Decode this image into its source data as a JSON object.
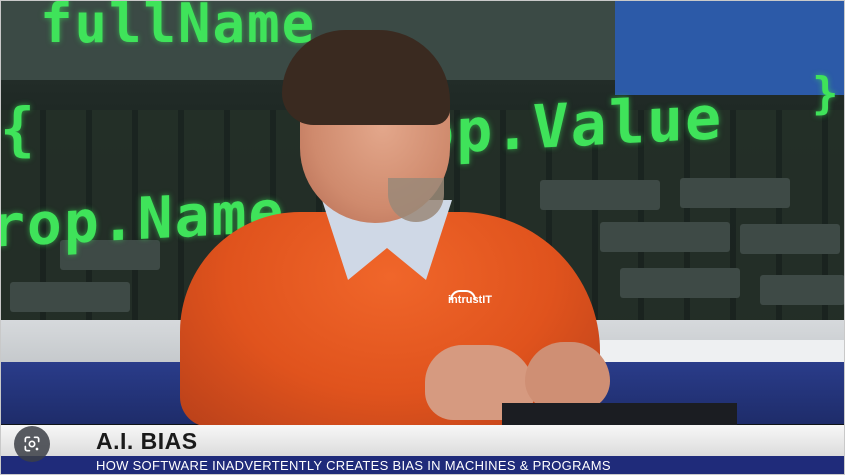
{
  "background": {
    "code_lines": [
      "fullName",
      "rop.Value",
      "rop.Name",
      "{",
      "}"
    ]
  },
  "shirt_logo": "intrustIT",
  "lower_third": {
    "title": "A.I. BIAS",
    "subtitle": "HOW SOFTWARE INADVERTENTLY CREATES BIAS IN MACHINES & PROGRAMS"
  },
  "overlay": {
    "lens_icon": "google-lens-icon"
  },
  "colors": {
    "code_green": "#3fe35a",
    "shirt_orange": "#e0531d",
    "banner_blue": "#1f2b7a"
  }
}
